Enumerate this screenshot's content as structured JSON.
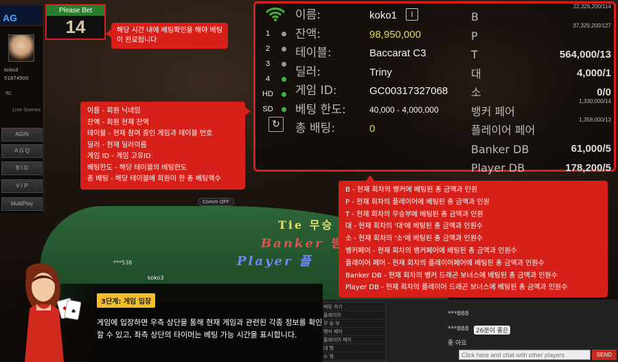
{
  "logo": {
    "text": "AG"
  },
  "timer": {
    "label": "Please Bet",
    "seconds": "14"
  },
  "timer_callout": {
    "text": "해당 시간 내에 베팅확인을 해야 베팅이 완료됩니다"
  },
  "sidebar": {
    "username": "koko3",
    "balance": "51874500",
    "rc_label": "RC",
    "live_label": "Live Games",
    "nav": [
      "AGIN",
      "A G Q",
      "B I D",
      "V I P",
      "MultiPlay"
    ]
  },
  "info_callout": {
    "lines": [
      "이름 - 회원 닉네임",
      "잔액 - 회원 현재 잔액",
      "테이블 - 현재 참여 중인 게임과 테이블 번호",
      "딜러 - 현재 딜러이름",
      "게임 ID - 게임 고유ID",
      "베팅한도 - 해당 테이블의 베팅한도",
      "총 배팅 - 해당 테이블에 회원이 한 총 베팅액수"
    ]
  },
  "panel": {
    "rows": [
      "1",
      "2",
      "3",
      "4",
      "HD",
      "SD"
    ],
    "info_icon": "i",
    "labels": {
      "name": "이름:",
      "balance": "잔액:",
      "table": "테이블:",
      "dealer": "딜러:",
      "game_id": "게임 ID:",
      "bet_limit": "베팅 한도:",
      "total_bet": "총 배팅:"
    },
    "values": {
      "name": "koko1",
      "balance": "98,950,000",
      "table": "Baccarat C3",
      "dealer": "Triny",
      "game_id": "GC00317327068",
      "bet_limit": "40,000 - 4,000,000",
      "total_bet": "0"
    },
    "bets": [
      {
        "label": "B",
        "small": "22,326,200/114",
        "big": ""
      },
      {
        "label": "P",
        "small": "37,329,200/127",
        "big": ""
      },
      {
        "label": "T",
        "small": "",
        "big": "564,000/13"
      },
      {
        "label": "대",
        "small": "",
        "big": "4,000/1"
      },
      {
        "label": "소",
        "small": "",
        "big": "0/0"
      },
      {
        "label": "뱅커 페어",
        "small": "1,330,000/14",
        "big": ""
      },
      {
        "label": "플레이어 페어",
        "small": "1,358,000/13",
        "big": ""
      },
      {
        "label": "Banker DB",
        "small": "",
        "big": "61,000/5"
      },
      {
        "label": "Player DB",
        "small": "",
        "big": "178,200/5"
      }
    ]
  },
  "bet_callout": {
    "lines": [
      "B - 현재 회차의 뱅커에 베팅된 총 금액과 인원",
      "P - 현재 회차의 플레이어에 베팅된 총 금액과 인원",
      "T - 현재 회차의 무승부에 베팅된 총 금액과 인원",
      "대 - 현재 회차의 '대'에 베팅된 총 금액과 인원수",
      "소 - 현재 회차의 '소'에 베팅된 총 금액과 인원수",
      "뱅커페어 - 현재 회차의 뱅커페어에 베팅된 총 금액과 인원수",
      "플레이어 페어 - 현재 회차의 플레이어페어에 베팅된 총 금액과 인원수",
      "Banker DB - 현재 회차의 뱅커 드래곤 보너스에 베팅된 총 금액과 인원수",
      "Player DB - 현재 회차의 플레이어 드래곤 보너스에 베팅된 총 금액과 인원수"
    ]
  },
  "felt": {
    "tie": "Tie 무승",
    "banker": "Banker 뱅",
    "player": "Player 플",
    "chip": "***538",
    "user": "koko3",
    "comm": "Comm OFF"
  },
  "chat": {
    "side": [
      "배팅 하기",
      "플레이어",
      "무 승 부",
      "뱅커 페어",
      "플레이어 페어",
      "대 형",
      "소 형"
    ],
    "messages": [
      "***888",
      "***888",
      "26분이 좋은",
      "좋 아요"
    ],
    "input_placeholder": "Click here and chat with other players",
    "send_label": "SEND"
  },
  "step": {
    "tag": "3단계: 게임 입장",
    "text": "게임에 입장하면 우측 상단을 통해 현재 게임과 관련된 각종 정보를 확인할 수 있고, 좌측 상단의 타이머는 베팅 가능 시간을 표시합니다."
  },
  "colors": {
    "callout_red": "#d8201a",
    "timer_green": "#2b7d2e",
    "step_tag_yellow": "#f2bf2a",
    "balance_yellow": "#e5d95a"
  }
}
